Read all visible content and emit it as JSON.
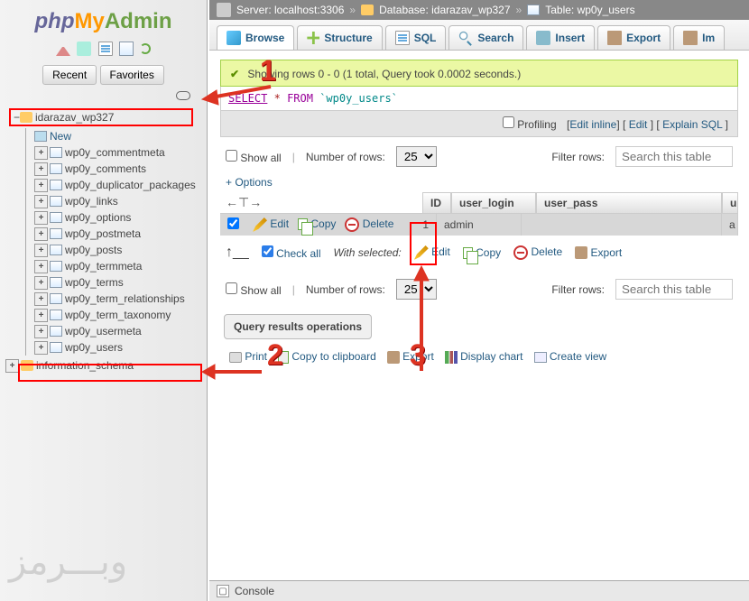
{
  "logo": {
    "php": "php",
    "my": "My",
    "admin": "Admin"
  },
  "sidebar": {
    "recent": "Recent",
    "favorites": "Favorites",
    "db": "idarazav_wp327",
    "new": "New",
    "tables": [
      "wp0y_commentmeta",
      "wp0y_comments",
      "wp0y_duplicator_packages",
      "wp0y_links",
      "wp0y_options",
      "wp0y_postmeta",
      "wp0y_posts",
      "wp0y_termmeta",
      "wp0y_terms",
      "wp0y_term_relationships",
      "wp0y_term_taxonomy",
      "wp0y_usermeta",
      "wp0y_users"
    ],
    "info_schema": "information_schema"
  },
  "breadcrumb": {
    "server": "Server: localhost:3306",
    "database": "Database: idarazav_wp327",
    "table": "Table: wp0y_users"
  },
  "tabs": {
    "browse": "Browse",
    "structure": "Structure",
    "sql": "SQL",
    "search": "Search",
    "insert": "Insert",
    "export": "Export",
    "import": "Im"
  },
  "message": "Showing rows 0 - 0 (1 total, Query took 0.0002 seconds.)",
  "query": {
    "select": "SELECT",
    "star": "*",
    "from": "FROM",
    "table": "`wp0y_users`"
  },
  "graybar": {
    "profiling": "Profiling",
    "editinline": "Edit inline",
    "edit": "Edit",
    "explain": "Explain SQL"
  },
  "filter": {
    "showall": "Show all",
    "numrows": "Number of rows:",
    "value": "25",
    "filterrows": "Filter rows:",
    "placeholder": "Search this table"
  },
  "options": "+ Options",
  "cols": {
    "id": "ID",
    "user_login": "user_login",
    "user_pass": "user_pass",
    "u": "u"
  },
  "row": {
    "edit": "Edit",
    "copy": "Copy",
    "delete": "Delete",
    "id": "1",
    "user_login": "admin",
    "user_pass": "",
    "u": "a"
  },
  "withsel": {
    "checkall": "Check all",
    "with": "With selected:",
    "edit": "Edit",
    "copy": "Copy",
    "delete": "Delete",
    "export": "Export"
  },
  "qro": "Query results operations",
  "bottom": {
    "print": "Print",
    "copyclip": "Copy to clipboard",
    "export": "Export",
    "chart": "Display chart",
    "view": "Create view"
  },
  "console": "Console",
  "ann": {
    "n1": "1",
    "n2": "2",
    "n3": "3"
  },
  "watermark": "وبـــرمز"
}
